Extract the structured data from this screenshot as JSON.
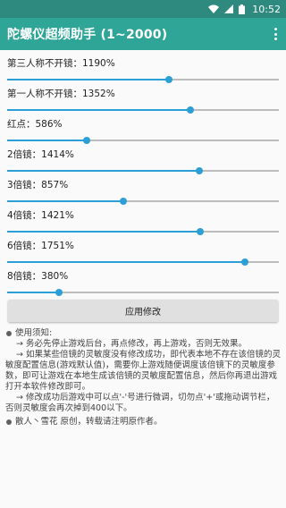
{
  "status_bar": {
    "time": "10:52",
    "icons": [
      "wifi-icon",
      "signal-icon",
      "battery-icon"
    ]
  },
  "app_bar": {
    "title": "陀螺仪超频助手 (1~2000)",
    "menu_icon": "more-vert-icon"
  },
  "colors": {
    "status_bar": "#2e8a7e",
    "app_bar": "#2fa597",
    "slider_accent": "#2b9fd6",
    "slider_track": "#bdbdbd"
  },
  "slider_range": [
    1,
    2000
  ],
  "settings": [
    {
      "label": "第三人称不开镜：1190%",
      "value": 1190
    },
    {
      "label": "第一人称不开镜：1352%",
      "value": 1352
    },
    {
      "label": "红点：586%",
      "value": 586
    },
    {
      "label": "2倍镜：1414%",
      "value": 1414
    },
    {
      "label": "3倍镜：857%",
      "value": 857
    },
    {
      "label": "4倍镜：1421%",
      "value": 1421
    },
    {
      "label": "6倍镜：1751%",
      "value": 1751
    },
    {
      "label": "8倍镜：380%",
      "value": 380
    }
  ],
  "apply_button": "应用修改",
  "notes": {
    "heading": "使用须知:",
    "items": [
      "→ 务必先停止游戏后台，再点修改，再上游戏，否则无效果。",
      "→ 如果某些倍镜的灵敏度没有修改成功，即代表本地不存在该倍镜的灵敏度配置信息(游戏默认值)，需要你上游戏随便调度该倍镜下的灵敏度参数，即可让游戏在本地生成该倍镜的灵敏度配置信息，然后你再退出游戏打开本软件修改即可。",
      "→ 修改成功后游戏中可以点'-'号进行微调，切勿点'+'或拖动调节栏，否则灵敏度会再次掉到400以下。"
    ],
    "footer": "散人丶雪花 原创，转载请注明原作者。"
  }
}
